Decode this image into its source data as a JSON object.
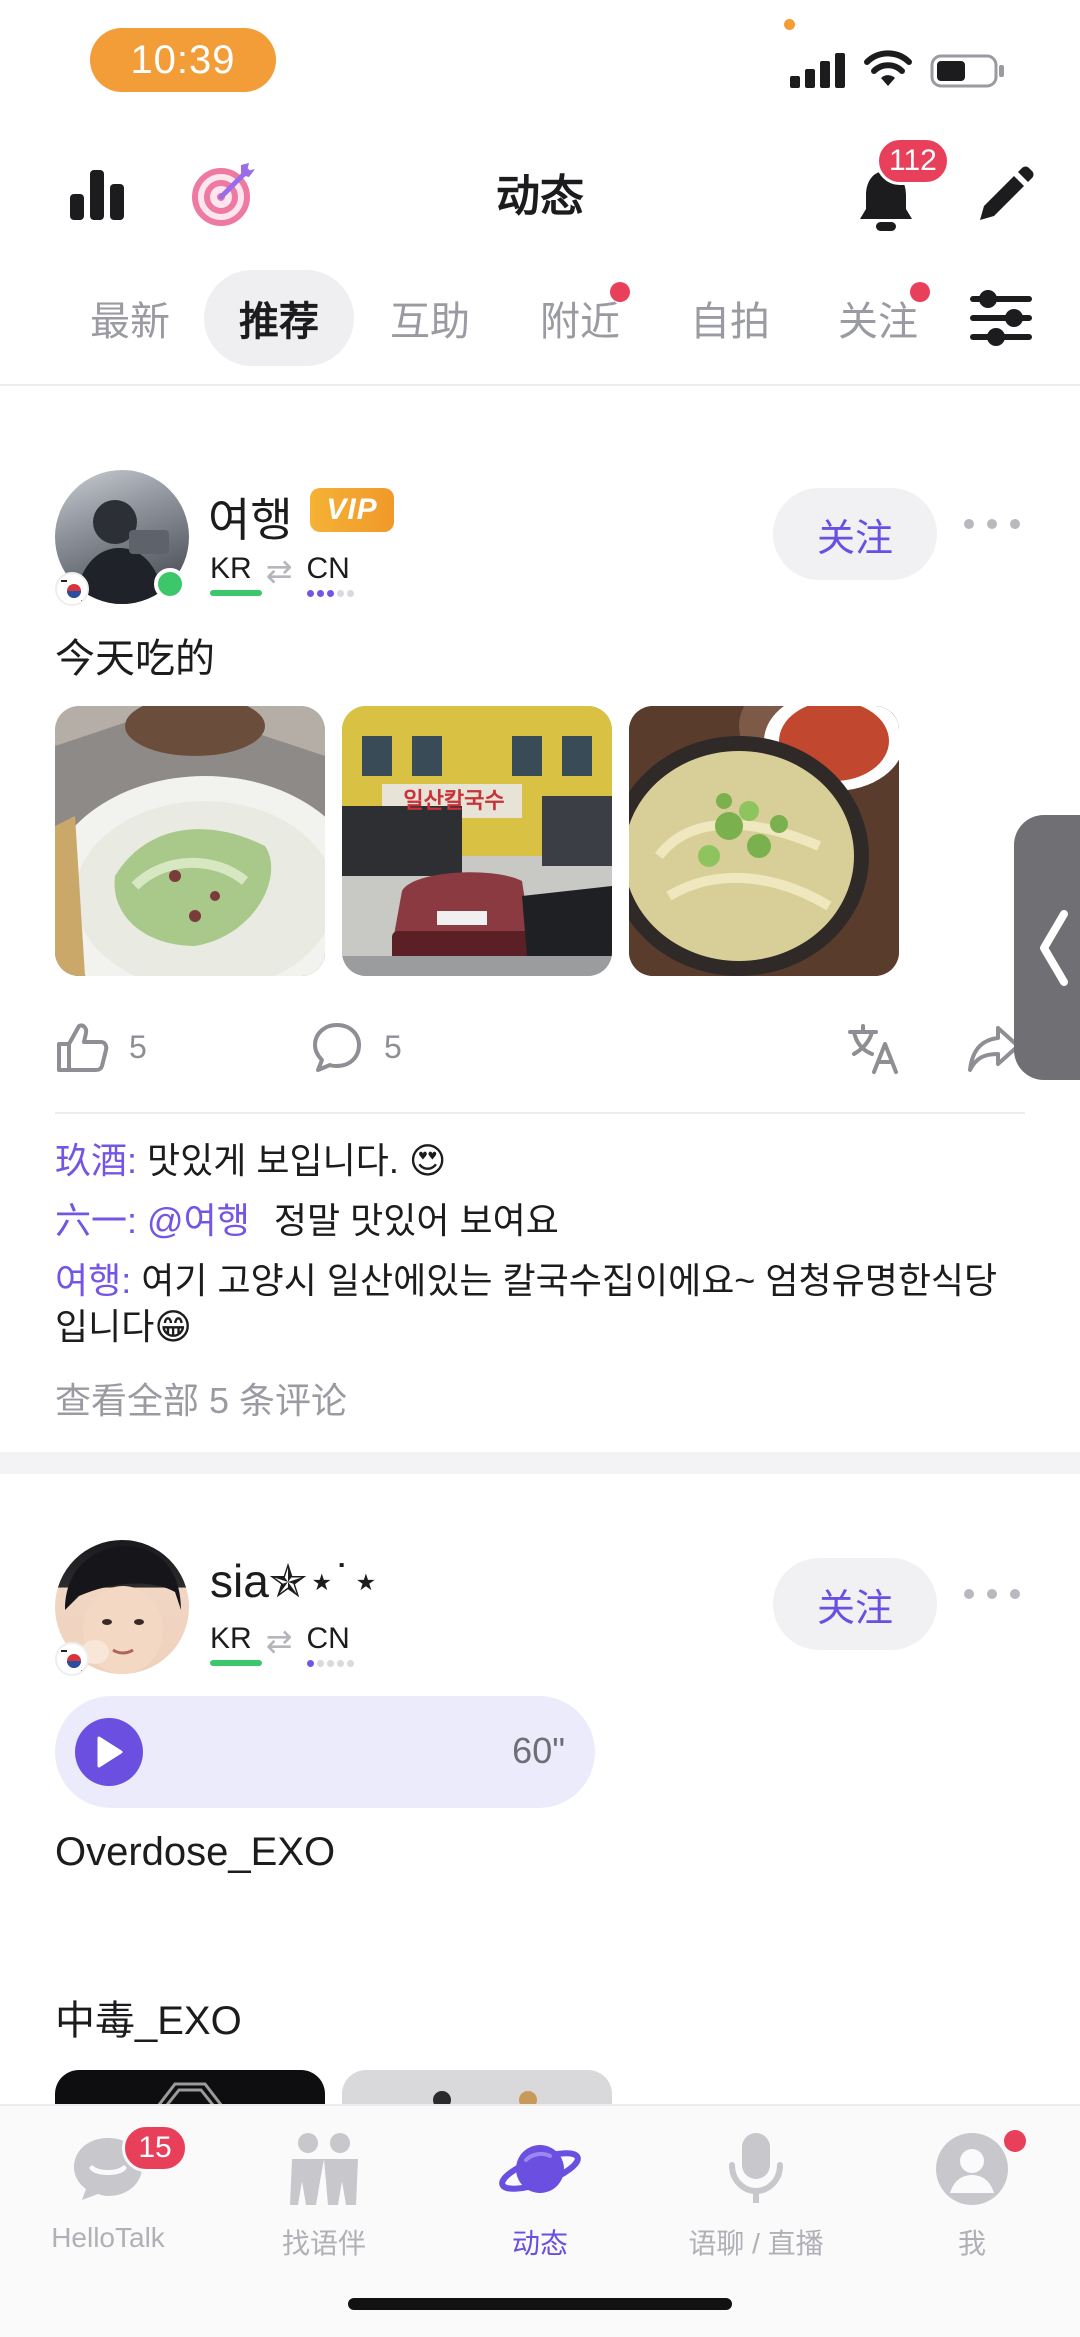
{
  "status_bar": {
    "time": "10:39"
  },
  "header": {
    "title": "动态",
    "notification_count": "112"
  },
  "tabs": [
    {
      "label": "最新"
    },
    {
      "label": "推荐"
    },
    {
      "label": "互助"
    },
    {
      "label": "附近"
    },
    {
      "label": "自拍"
    },
    {
      "label": "关注"
    }
  ],
  "posts": [
    {
      "username": "여행",
      "badge": "VIP",
      "native_lang": "KR",
      "learning_lang": "CN",
      "follow_label": "关注",
      "text": "今天吃的",
      "likes": "5",
      "comments_count": "5",
      "comments": [
        {
          "author": "玖酒:",
          "text": "맛있게 보입니다. 😍"
        },
        {
          "author": "六一:",
          "mention": "@여행",
          "text": "정말 맛있어 보여요"
        },
        {
          "author": "여행:",
          "text": "여기 고양시 일산에있는 칼국수집이에요~  엄청유명한식당입니다😁"
        }
      ],
      "view_all": "查看全部 5 条评论",
      "photos": [
        "salad photo",
        "restaurant storefront photo",
        "noodle soup photo"
      ],
      "sign_text": "일산칼국수"
    },
    {
      "username": "sia✯⋆˙⋆",
      "native_lang": "KR",
      "learning_lang": "CN",
      "follow_label": "关注",
      "audio_duration": "60\"",
      "text_line1": "Overdose_EXO",
      "text_line2": "中毒_EXO"
    }
  ],
  "bottom_nav": [
    {
      "label": "HelloTalk",
      "badge": "15"
    },
    {
      "label": "找语伴"
    },
    {
      "label": "动态"
    },
    {
      "label": "语聊 / 直播"
    },
    {
      "label": "我"
    }
  ],
  "colors": {
    "accent": "#6a4fe0",
    "badge": "#e8405a",
    "time_pill": "#f29d38",
    "online": "#3cc76a"
  }
}
